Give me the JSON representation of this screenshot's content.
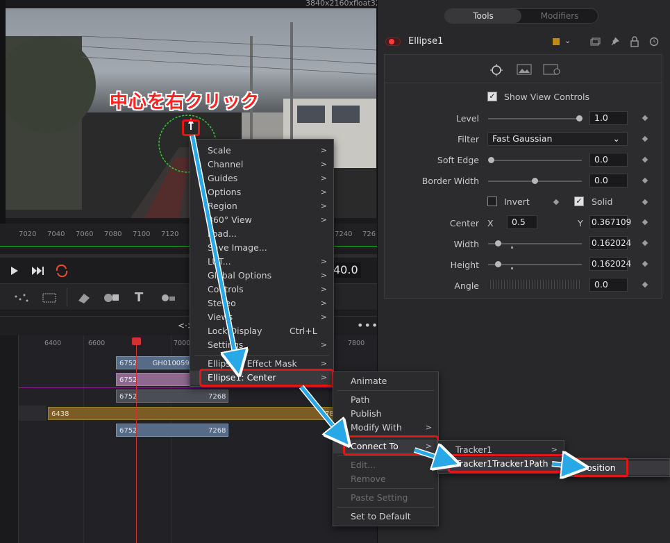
{
  "viewer": {
    "resolution": "3840x2160xfloat32",
    "timecode": "40.0"
  },
  "annotation": "中心を右クリック",
  "ruler_ticks": [
    "7020",
    "7040",
    "7060",
    "7080",
    "7100",
    "7120",
    "7240",
    "726"
  ],
  "timeline_ticks": [
    "6400",
    "6600",
    "7000",
    "7800"
  ],
  "clips": {
    "c1_start": "6752",
    "c1_name": "GH010059.M",
    "c2_start": "6752",
    "c3_start": "6752",
    "c3_end": "7268",
    "c4_start": "6438",
    "c4_end": "78",
    "c5_start": "6752",
    "c5_end": "7268"
  },
  "inspector": {
    "tabs": [
      "Tools",
      "Modifiers"
    ],
    "node_name": "Ellipse1",
    "show_view_controls": "Show View Controls",
    "level_label": "Level",
    "level_value": "1.0",
    "filter_label": "Filter",
    "filter_value": "Fast Gaussian",
    "soft_edge_label": "Soft Edge",
    "soft_edge_value": "0.0",
    "border_width_label": "Border Width",
    "border_width_value": "0.0",
    "invert_label": "Invert",
    "solid_label": "Solid",
    "center_label": "Center",
    "x_label": "X",
    "center_x": "0.5",
    "y_label": "Y",
    "center_y": "0.367109",
    "width_label": "Width",
    "width_value": "0.162024",
    "height_label": "Height",
    "height_value": "0.162024",
    "angle_label": "Angle",
    "angle_value": "0.0"
  },
  "menu1": {
    "items": [
      "Scale",
      "Channel",
      "Guides",
      "Options",
      "Region",
      "360° View",
      "Load...",
      "Save Image...",
      "LUT...",
      "Global Options",
      "Controls",
      "Stereo",
      "Views",
      "Lock Display",
      "Settings",
      "Ellipse1: Effect Mask",
      "Ellipse1: Center"
    ],
    "lock_shortcut": "Ctrl+L"
  },
  "menu2": {
    "items": [
      "Animate",
      "Path",
      "Publish",
      "Modify With",
      "Connect To",
      "Edit...",
      "Remove",
      "Paste Setting",
      "Set to Default"
    ]
  },
  "menu3": {
    "items": [
      "Tracker1",
      "Tracker1Tracker1Path"
    ]
  },
  "menu4": {
    "items": [
      "Position"
    ]
  },
  "colors": {
    "accent": "#e41515",
    "arrow": "#29a8e8",
    "node_swatch": "#c08a1a"
  }
}
